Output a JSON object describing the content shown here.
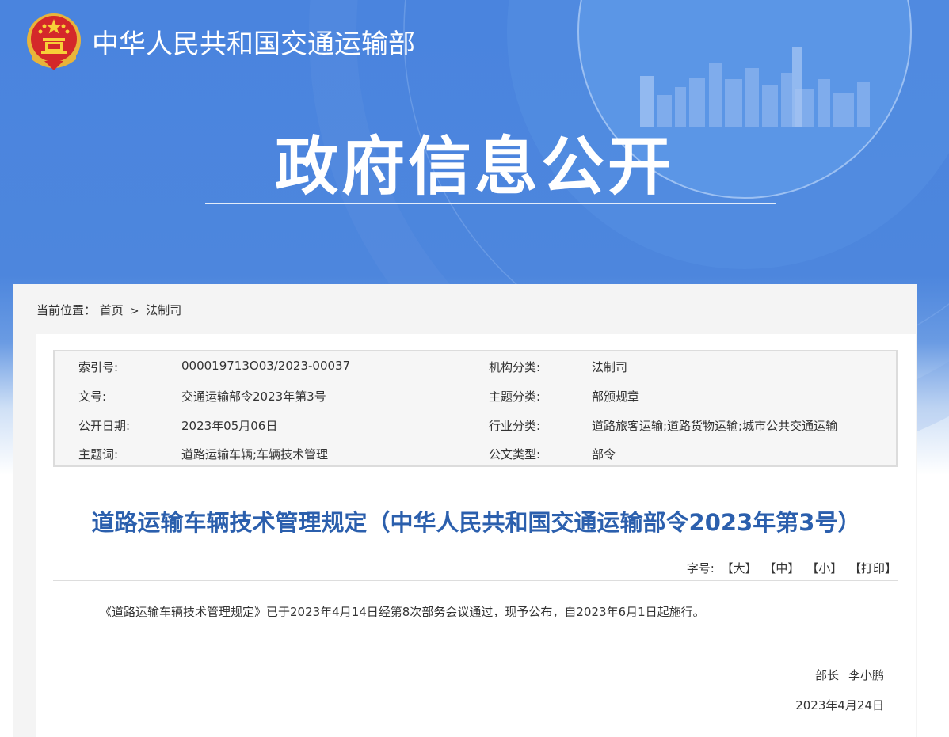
{
  "header": {
    "site_name": "中华人民共和国交通运输部",
    "banner_title": "政府信息公开"
  },
  "breadcrumb": {
    "label": "当前位置：",
    "items": [
      "首页",
      "法制司"
    ],
    "separator": ">"
  },
  "meta": {
    "rows": [
      {
        "label1": "索引号:",
        "value1": "000019713O03/2023-00037",
        "label2": "机构分类:",
        "value2": "法制司"
      },
      {
        "label1": "文号:",
        "value1": "交通运输部令2023年第3号",
        "label2": "主题分类:",
        "value2": "部颁规章"
      },
      {
        "label1": "公开日期:",
        "value1": "2023年05月06日",
        "label2": "行业分类:",
        "value2": "道路旅客运输;道路货物运输;城市公共交通运输"
      },
      {
        "label1": "主题词:",
        "value1": "道路运输车辆;车辆技术管理",
        "label2": "公文类型:",
        "value2": "部令"
      }
    ]
  },
  "article": {
    "title": "道路运输车辆技术管理规定（中华人民共和国交通运输部令2023年第3号）",
    "font_size_label": "字号:",
    "font_large": "【大】",
    "font_medium": "【中】",
    "font_small": "【小】",
    "print": "【打印】",
    "body": "《道路运输车辆技术管理规定》已于2023年4月14日经第8次部务会议通过，现予公布，自2023年6月1日起施行。",
    "signer_title": "部长",
    "signer_name": "李小鹏",
    "sign_date": "2023年4月24日"
  },
  "colors": {
    "banner_blue": "#4a84de",
    "title_blue": "#2b5fad"
  }
}
